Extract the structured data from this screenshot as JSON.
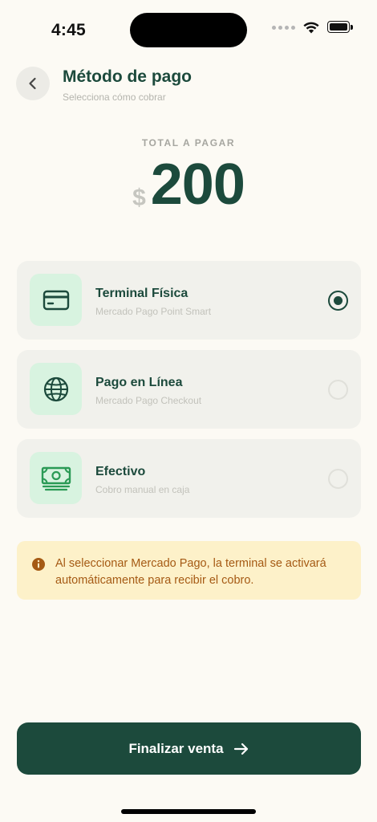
{
  "status_bar": {
    "time": "4:45"
  },
  "header": {
    "title": "Método de pago",
    "subtitle": "Selecciona cómo cobrar",
    "back_icon": "chevron-left-icon"
  },
  "total": {
    "label": "TOTAL A PAGAR",
    "currency": "$",
    "amount": "200"
  },
  "payment_options": [
    {
      "title": "Terminal Física",
      "subtitle": "Mercado Pago Point Smart",
      "icon": "credit-card-icon",
      "selected": true
    },
    {
      "title": "Pago en Línea",
      "subtitle": "Mercado Pago Checkout",
      "icon": "globe-icon",
      "selected": false
    },
    {
      "title": "Efectivo",
      "subtitle": "Cobro manual en caja",
      "icon": "cash-icon",
      "selected": false
    }
  ],
  "info": {
    "icon": "info-icon",
    "text": "Al seleccionar Mercado Pago, la terminal se activará automáticamente para recibir el cobro."
  },
  "finalize": {
    "label": "Finalizar venta",
    "icon": "arrow-right-icon"
  },
  "colors": {
    "background": "#fcfaf4",
    "primary": "#1c4a3c",
    "icon_background": "#d8f3e0",
    "icon_green": "#2a9a55",
    "info_background": "#fdf1c9",
    "info_text": "#a55a14"
  }
}
